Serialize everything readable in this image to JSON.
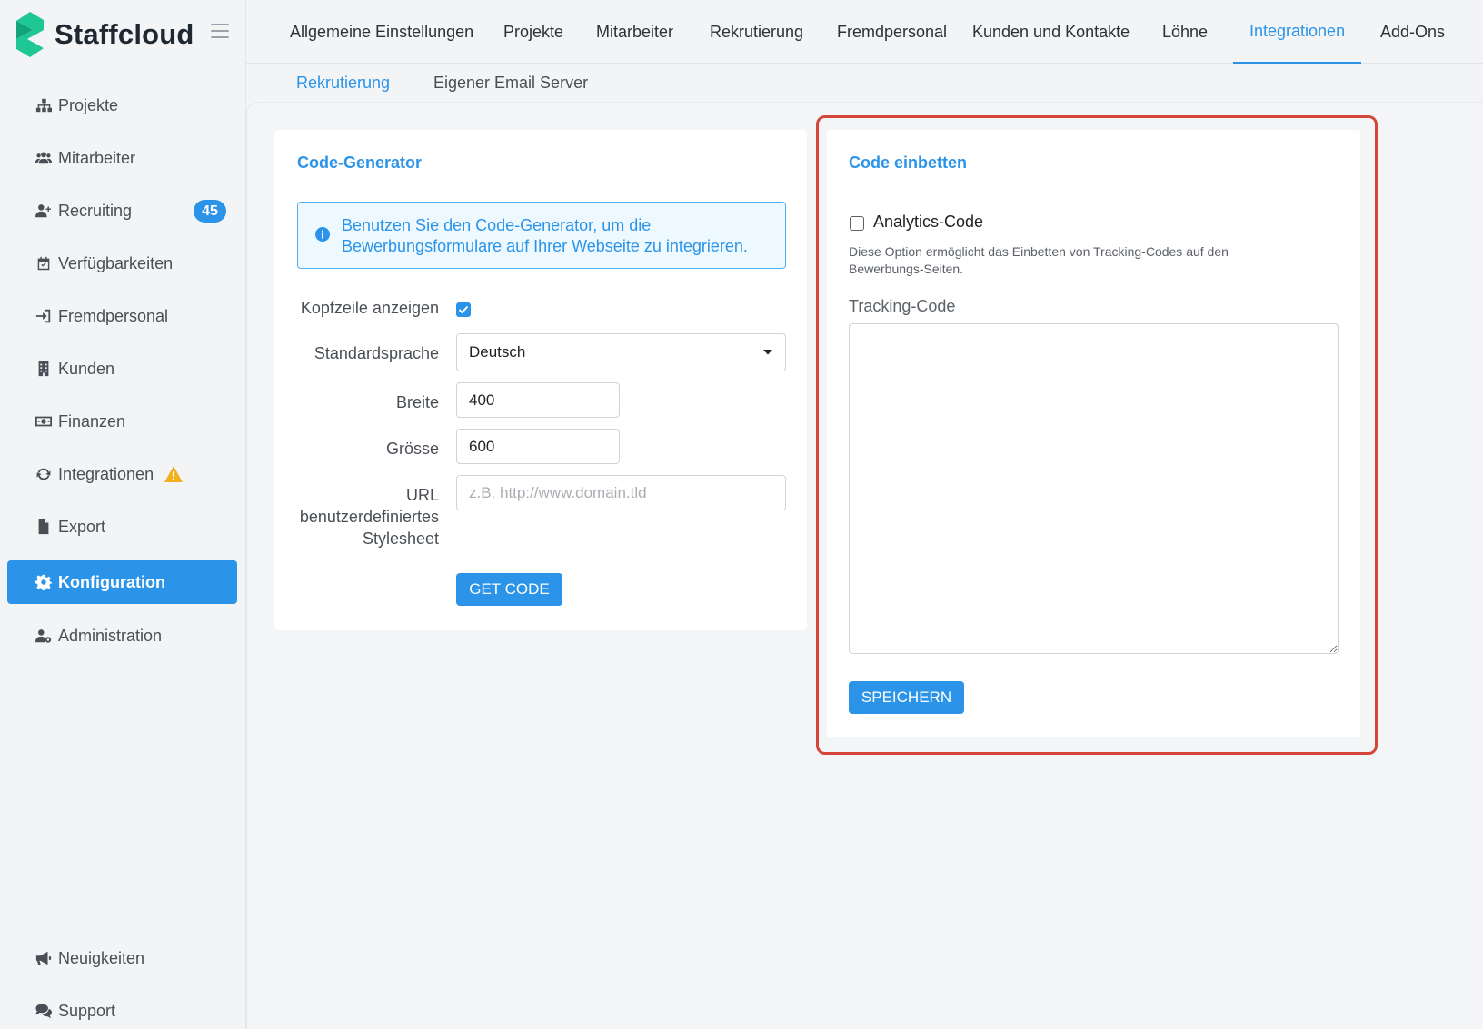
{
  "app": {
    "name": "Staffcloud"
  },
  "sidebar": {
    "items": [
      {
        "label": "Projekte"
      },
      {
        "label": "Mitarbeiter"
      },
      {
        "label": "Recruiting",
        "badge": "45"
      },
      {
        "label": "Verfügbarkeiten"
      },
      {
        "label": "Fremdpersonal"
      },
      {
        "label": "Kunden"
      },
      {
        "label": "Finanzen"
      },
      {
        "label": "Integrationen"
      },
      {
        "label": "Export"
      },
      {
        "label": "Konfiguration"
      },
      {
        "label": "Administration"
      }
    ],
    "bottom": [
      {
        "label": "Neuigkeiten"
      },
      {
        "label": "Support"
      }
    ],
    "active_index": 9
  },
  "topnav": {
    "tabs": [
      {
        "label": "Allgemeine Einstellungen"
      },
      {
        "label": "Projekte"
      },
      {
        "label": "Mitarbeiter"
      },
      {
        "label": "Rekrutierung"
      },
      {
        "label": "Fremdpersonal"
      },
      {
        "label": "Kunden und Kontakte"
      },
      {
        "label": "Löhne"
      },
      {
        "label": "Integrationen"
      },
      {
        "label": "Add-Ons"
      }
    ],
    "active_index": 7
  },
  "subnav": {
    "tabs": [
      {
        "label": "Rekrutierung"
      },
      {
        "label": "Eigener Email Server"
      }
    ],
    "active_index": 0
  },
  "code_generator": {
    "title": "Code-Generator",
    "info": "Benutzen Sie den Code-Generator, um die Bewerbungsformulare auf Ihrer Webseite zu integrieren.",
    "fields": {
      "header_label": "Kopfzeile anzeigen",
      "header_checked": true,
      "language_label": "Standardsprache",
      "language_value": "Deutsch",
      "width_label": "Breite",
      "width_value": "400",
      "height_label": "Grösse",
      "height_value": "600",
      "url_label_1": "URL",
      "url_label_2": "benutzerdefiniertes",
      "url_label_3": "Stylesheet",
      "url_placeholder": "z.B. http://www.domain.tld"
    },
    "button": "GET CODE"
  },
  "embed_code": {
    "title": "Code einbetten",
    "analytics_label": "Analytics-Code",
    "analytics_checked": false,
    "analytics_help": "Diese Option ermöglicht das Einbetten von Tracking-Codes auf den Bewerbungs-Seiten.",
    "tracking_label": "Tracking-Code",
    "tracking_value": "",
    "button": "SPEICHERN"
  },
  "colors": {
    "accent": "#2b94e8",
    "highlight": "#d6453a",
    "logo": "#1fc795"
  }
}
